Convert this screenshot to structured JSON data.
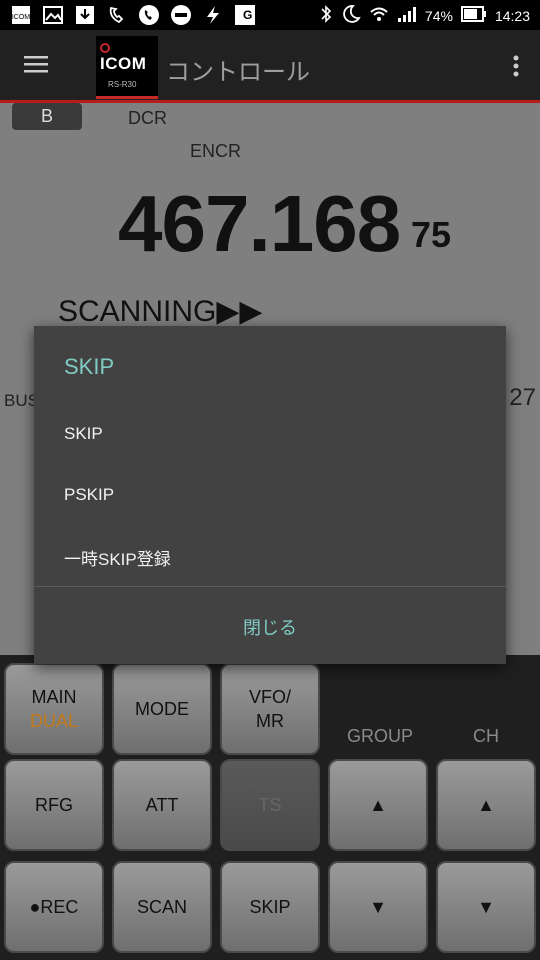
{
  "status_bar": {
    "left_icons": [
      "icom-app-icon",
      "image-icon",
      "download-icon",
      "call-forwarding-icon",
      "phone-icon",
      "do-not-disturb-icon",
      "flash-icon",
      "translate-icon"
    ],
    "battery": "74%",
    "time": "14:23"
  },
  "app_bar": {
    "logo_brand": "ICOM",
    "logo_model": "RS-R30",
    "title": "コントロール"
  },
  "display": {
    "band_button": "B",
    "dcr": "DCR",
    "encr": "ENCR",
    "frequency_main": "467.168",
    "frequency_sub": "75",
    "scanning": "SCANNING▶▶",
    "busy": "BUS",
    "right_number": "27"
  },
  "dialog": {
    "title": "SKIP",
    "items": [
      "SKIP",
      "PSKIP",
      "一時SKIP登録"
    ],
    "close": "閉じる"
  },
  "panel": {
    "main": "MAIN",
    "dual": "DUAL",
    "mode": "MODE",
    "vfo_line1": "VFO/",
    "vfo_line2": "MR",
    "group_label": "GROUP",
    "ch_label": "CH",
    "rfg": "RFG",
    "att": "ATT",
    "ts": "TS",
    "rec": "●REC",
    "scan": "SCAN",
    "skip": "SKIP",
    "up_arrow": "▲",
    "down_arrow": "▼"
  }
}
